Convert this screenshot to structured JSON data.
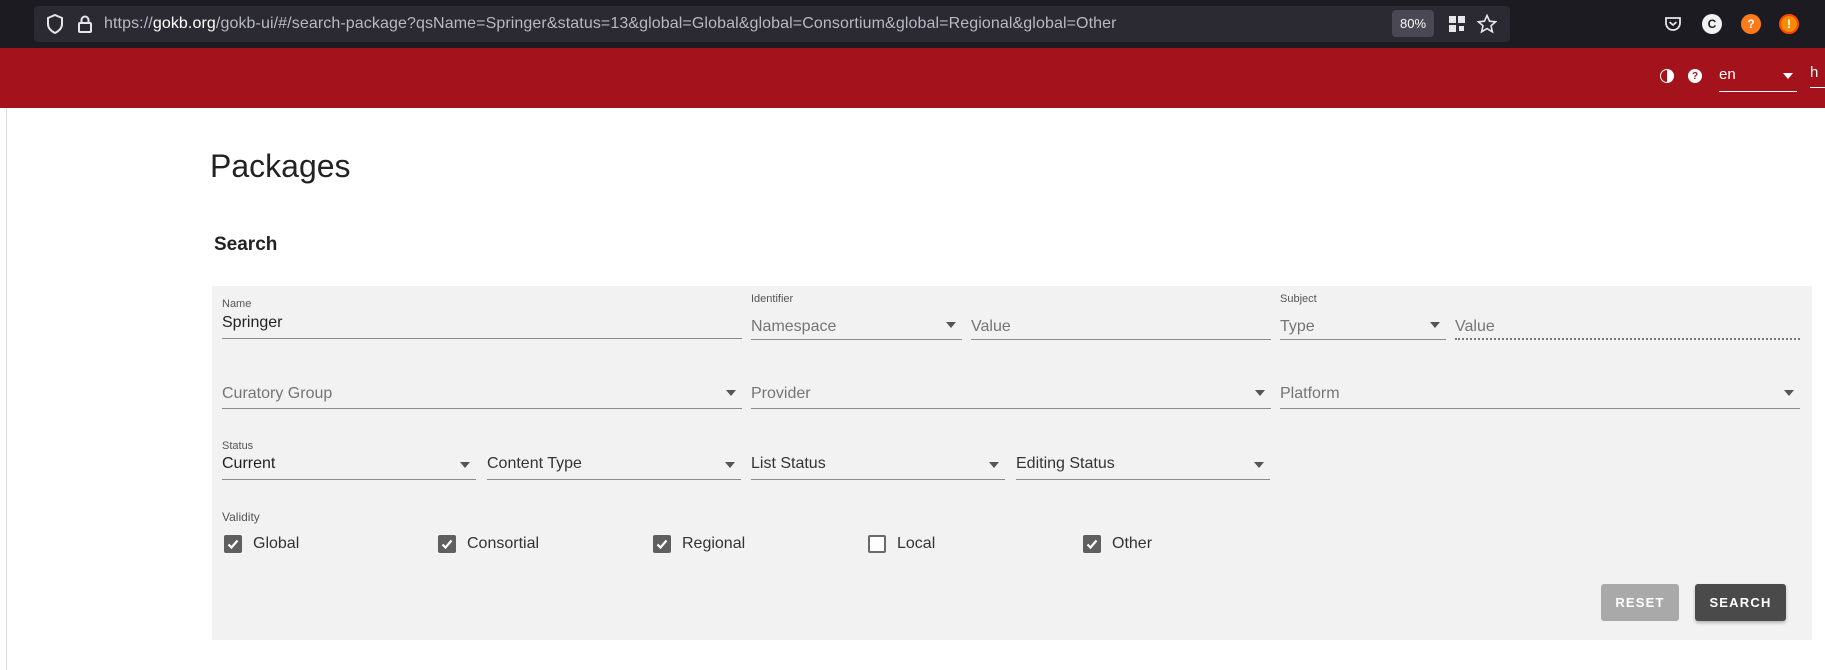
{
  "browser": {
    "url_prefix": "https://",
    "url_host": "gokb.org",
    "url_path": "/gokb-ui/#/search-package?qsName=Springer&status=13&global=Global&global=Consortium&global=Regional&global=Other",
    "zoom": "80%",
    "icons": [
      "shield-icon",
      "lock-icon",
      "qr-code-icon",
      "bookmark-star-icon",
      "pocket-icon",
      "extension-c-icon",
      "extension-ghostery-icon",
      "extension-orange-icon"
    ]
  },
  "header": {
    "language": "en",
    "cut_text": "h",
    "icons": [
      "contrast-icon",
      "help-icon"
    ],
    "accent_color": "#a4131c"
  },
  "page": {
    "title": "Packages",
    "section_title": "Search"
  },
  "search": {
    "name": {
      "label": "Name",
      "value": "Springer"
    },
    "identifier": {
      "label": "Identifier",
      "namespace_placeholder": "Namespace",
      "value_placeholder": "Value"
    },
    "subject": {
      "label": "Subject",
      "type_placeholder": "Type",
      "value_placeholder": "Value"
    },
    "curatory_group": {
      "placeholder": "Curatory Group"
    },
    "provider": {
      "placeholder": "Provider"
    },
    "platform": {
      "placeholder": "Platform"
    },
    "status": {
      "label": "Status",
      "value": "Current"
    },
    "content_type": {
      "placeholder": "Content Type"
    },
    "list_status": {
      "placeholder": "List Status"
    },
    "editing_status": {
      "placeholder": "Editing Status"
    },
    "validity": {
      "label": "Validity",
      "options": [
        {
          "label": "Global",
          "checked": true
        },
        {
          "label": "Consortial",
          "checked": true
        },
        {
          "label": "Regional",
          "checked": true
        },
        {
          "label": "Local",
          "checked": false
        },
        {
          "label": "Other",
          "checked": true
        }
      ]
    },
    "reset_label": "RESET",
    "search_label": "SEARCH"
  }
}
